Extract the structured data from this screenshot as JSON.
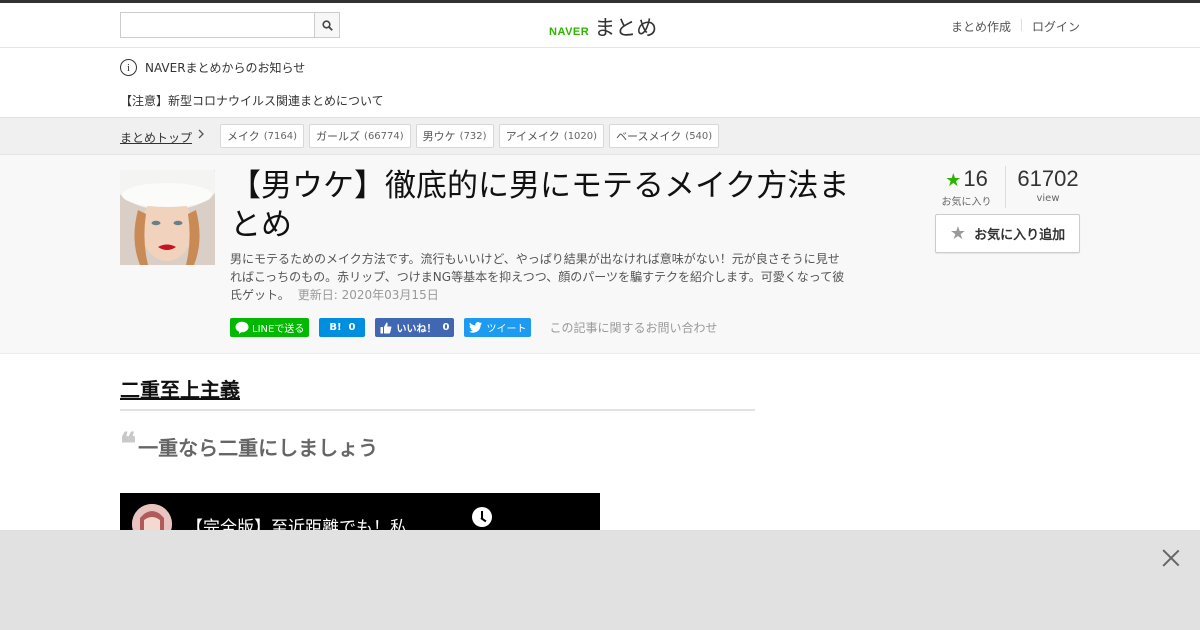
{
  "header": {
    "search_placeholder": "",
    "logo_naver": "NAVER",
    "logo_matome": "まとめ",
    "links": [
      "まとめ作成",
      "ログイン"
    ]
  },
  "notice": {
    "info_glyph": "i",
    "title": "NAVERまとめからのお知らせ",
    "item": "【注意】新型コロナウイルス関連まとめについて"
  },
  "breadcrumb": {
    "top": "まとめトップ",
    "tags": [
      {
        "label": "メイク",
        "count": "(7164)"
      },
      {
        "label": "ガールズ",
        "count": "(66774)"
      },
      {
        "label": "男ウケ",
        "count": "(732)"
      },
      {
        "label": "アイメイク",
        "count": "(1020)"
      },
      {
        "label": "ベースメイク",
        "count": "(540)"
      }
    ]
  },
  "article": {
    "title": "【男ウケ】徹底的に男にモテるメイク方法まとめ",
    "description": "男にモテるためのメイク方法です。流行もいいけど、やっぱり結果が出なければ意味がない！元が良さそうに見せればこっちのもの。赤リップ、つけまNG等基本を抑えつつ、顔のパーツを騙すテクを紹介します。可愛くなって彼氏ゲット。",
    "updated": "更新日: 2020年03月15日",
    "favorites_count": "16",
    "favorites_label": "お気に入り",
    "views_count": "61702",
    "views_label": "view",
    "fav_button": "お気に入り追加"
  },
  "social": {
    "line": "LINEで送る",
    "hatena_icon": "B!",
    "hatena_count": "0",
    "fb_like": "いいね！",
    "fb_count": "0",
    "tweet": "ツイート",
    "contact": "この記事に関するお問い合わせ"
  },
  "content": {
    "heading": "二重至上主義",
    "quote_mark": "❝",
    "quote": "一重なら二重にしましょう",
    "video_title": "【完全版】至近距離でも！私"
  },
  "colors": {
    "brand_green": "#2db400",
    "hatena": "#008fde",
    "facebook": "#4267b2",
    "twitter": "#1d9bf0",
    "line": "#00b900"
  }
}
